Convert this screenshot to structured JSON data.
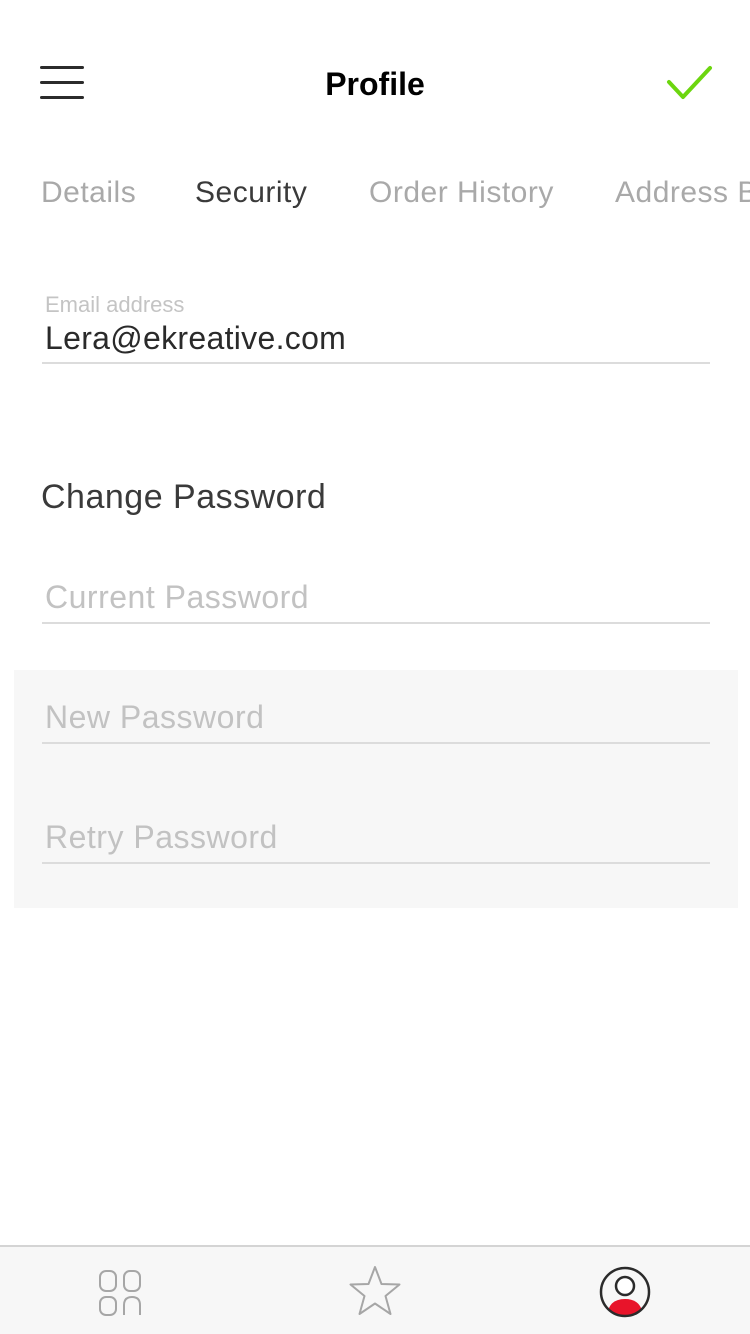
{
  "header": {
    "title": "Profile",
    "menu_icon": "hamburger-menu-icon",
    "save_icon": "checkmark-icon",
    "accent_color": "#6cd60f"
  },
  "tabs": [
    {
      "label": "Details",
      "active": false
    },
    {
      "label": "Security",
      "active": true
    },
    {
      "label": "Order History",
      "active": false
    },
    {
      "label": "Address Book",
      "active": false
    }
  ],
  "email": {
    "label": "Email address",
    "value": "Lera@ekreative.com"
  },
  "change_password": {
    "title": "Change Password",
    "current_placeholder": "Current Password",
    "new_placeholder": "New Password",
    "retry_placeholder": "Retry Password"
  },
  "tabbar": {
    "items": [
      {
        "icon": "catalog-grid-icon",
        "active": false
      },
      {
        "icon": "star-icon",
        "active": false
      },
      {
        "icon": "profile-user-icon",
        "active": true
      }
    ],
    "active_color": "#e8142a"
  }
}
